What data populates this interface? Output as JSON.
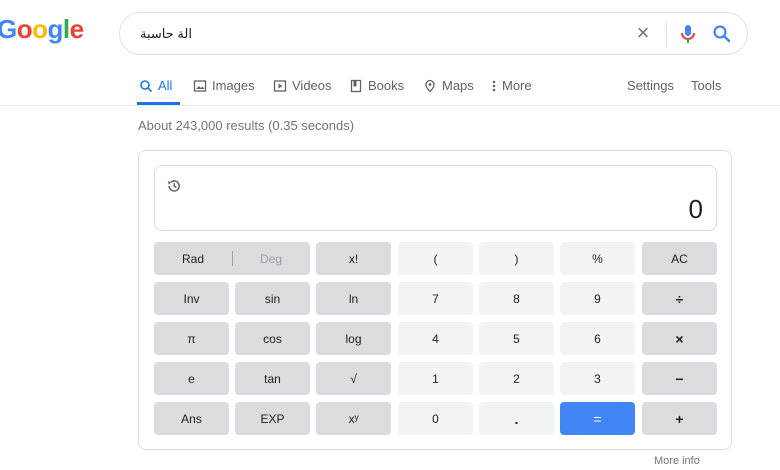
{
  "logo": {
    "letters": [
      "G",
      "o",
      "o",
      "g",
      "l",
      "e"
    ],
    "colors": [
      "#4285f4",
      "#ea4335",
      "#fbbc05",
      "#4285f4",
      "#34a853",
      "#ea4335"
    ]
  },
  "search": {
    "query": "الة حاسبة",
    "clear_icon": "×"
  },
  "tabs": [
    {
      "label": "All",
      "icon": "search-icon"
    },
    {
      "label": "Images",
      "icon": "image-icon"
    },
    {
      "label": "Videos",
      "icon": "play-icon"
    },
    {
      "label": "Books",
      "icon": "book-icon"
    },
    {
      "label": "Maps",
      "icon": "pin-icon"
    },
    {
      "label": "More",
      "icon": "more-dots-icon"
    }
  ],
  "tools": {
    "settings": "Settings",
    "tools": "Tools"
  },
  "results_stats": "About 243,000 results (0.35 seconds)",
  "calculator": {
    "display": "0",
    "angle": {
      "rad": "Rad",
      "deg": "Deg"
    },
    "rows": [
      [
        "x!",
        "(",
        ")",
        "%",
        "AC"
      ],
      [
        "Inv",
        "sin",
        "ln",
        "7",
        "8",
        "9",
        "÷"
      ],
      [
        "π",
        "cos",
        "log",
        "4",
        "5",
        "6",
        "×"
      ],
      [
        "e",
        "tan",
        "√",
        "1",
        "2",
        "3",
        "−"
      ],
      [
        "Ans",
        "EXP",
        "xʸ",
        "0",
        ".",
        "=",
        "+"
      ]
    ]
  },
  "more_info": "More info",
  "colors": {
    "accent": "#1a73e8",
    "equals": "#4285f4",
    "func_key": "#dadce0",
    "num_key": "#f1f3f4"
  }
}
